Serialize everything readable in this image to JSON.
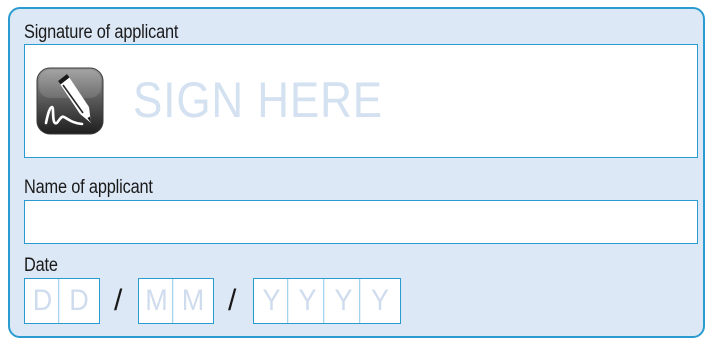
{
  "form": {
    "signature": {
      "label": "Signature of applicant",
      "placeholder": "SIGN HERE",
      "icon": "pen-sign-icon"
    },
    "name": {
      "label": "Name of applicant",
      "value": ""
    },
    "date": {
      "label": "Date",
      "separator": "/",
      "day": [
        "D",
        "D"
      ],
      "month": [
        "M",
        "M"
      ],
      "year": [
        "Y",
        "Y",
        "Y",
        "Y"
      ]
    }
  },
  "colors": {
    "panel_background": "#dde8f6",
    "border": "#2a9bd0",
    "placeholder_text": "#d4e1f1",
    "label_text": "#1a1a1a"
  }
}
